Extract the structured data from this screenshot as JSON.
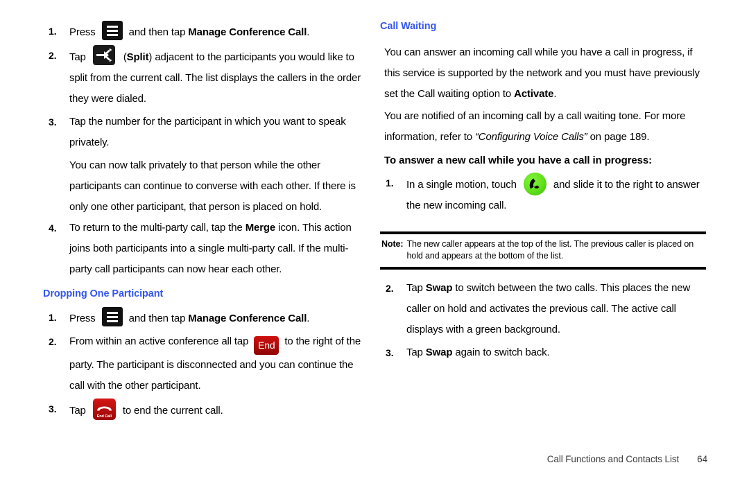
{
  "colors": {
    "heading_blue": "#3355ee",
    "icon_black": "#111111",
    "end_red": "#b30b0b",
    "answer_green": "#5ee01a",
    "rule_black": "#000000"
  },
  "left_column": {
    "steps_top": [
      {
        "num": "1.",
        "pre": "Press",
        "icon": "menu-icon",
        "mid": "and then tap",
        "bold": "Manage Conference Call",
        "post": "."
      },
      {
        "num": "2.",
        "pre": "Tap",
        "icon": "split-icon",
        "paren_open": "(",
        "bold": "Split",
        "paren_close": ")",
        "post": "adjacent to the participants you would like to split from the current call. The list displays the callers in the order they were dialed."
      },
      {
        "num": "3.",
        "text": "Tap the number for the participant in which you want to speak privately.",
        "followup": "You can now talk privately to that person while the other participants can continue to converse with each other. If there is only one other participant, that person is placed on hold."
      },
      {
        "num": "4.",
        "pre": "To return to the multi-party call, tap the",
        "bold": "Merge",
        "post": "icon. This action joins both participants into a single multi-party call. If the multi-party call participants can now hear each other."
      }
    ],
    "subsection_heading": "Dropping One Participant",
    "steps_bottom": [
      {
        "num": "1.",
        "pre": "Press",
        "icon": "menu-icon",
        "mid": "and then tap",
        "bold": "Manage Conference Call",
        "post": "."
      },
      {
        "num": "2.",
        "pre": "From within an active conference all tap",
        "icon": "end-button-icon",
        "icon_label": "End",
        "post": "to the right of the party. The participant is disconnected and you can continue the call with the other participant."
      },
      {
        "num": "3.",
        "pre": "Tap",
        "icon": "end-call-icon",
        "icon_label": "End Call",
        "post": "to end the current call."
      }
    ]
  },
  "right_column": {
    "heading": "Call Waiting",
    "paragraphs": [
      {
        "pre": "You can answer an incoming call while you have a call in progress, if this service is supported by the network and you must have previously set the Call waiting option to",
        "bold": "Activate",
        "post": "."
      },
      {
        "pre": "You are notified of an incoming call by a call waiting tone. For more information, refer to",
        "italic": "“Configuring Voice Calls”",
        "post": "on page 189."
      }
    ],
    "bold_lead": "To answer a new call while you have a call in progress:",
    "step_one": {
      "num": "1.",
      "pre": "In a single motion, touch",
      "icon": "answer-call-icon",
      "post": "and slide it to the right to answer the new incoming call."
    },
    "note": {
      "label": "Note:",
      "text": "The new caller appears at the top of the list. The previous caller is placed on hold and appears at the bottom of the list."
    },
    "steps_after_note": [
      {
        "num": "2.",
        "pre": "Tap",
        "bold": "Swap",
        "post": "to switch between the two calls. This places the new caller on hold and activates the previous call. The active call displays with a green background."
      },
      {
        "num": "3.",
        "pre": "Tap",
        "bold": "Swap",
        "post": "again to switch back."
      }
    ]
  },
  "footer": {
    "title": "Call Functions and Contacts List",
    "page_number": "64"
  }
}
